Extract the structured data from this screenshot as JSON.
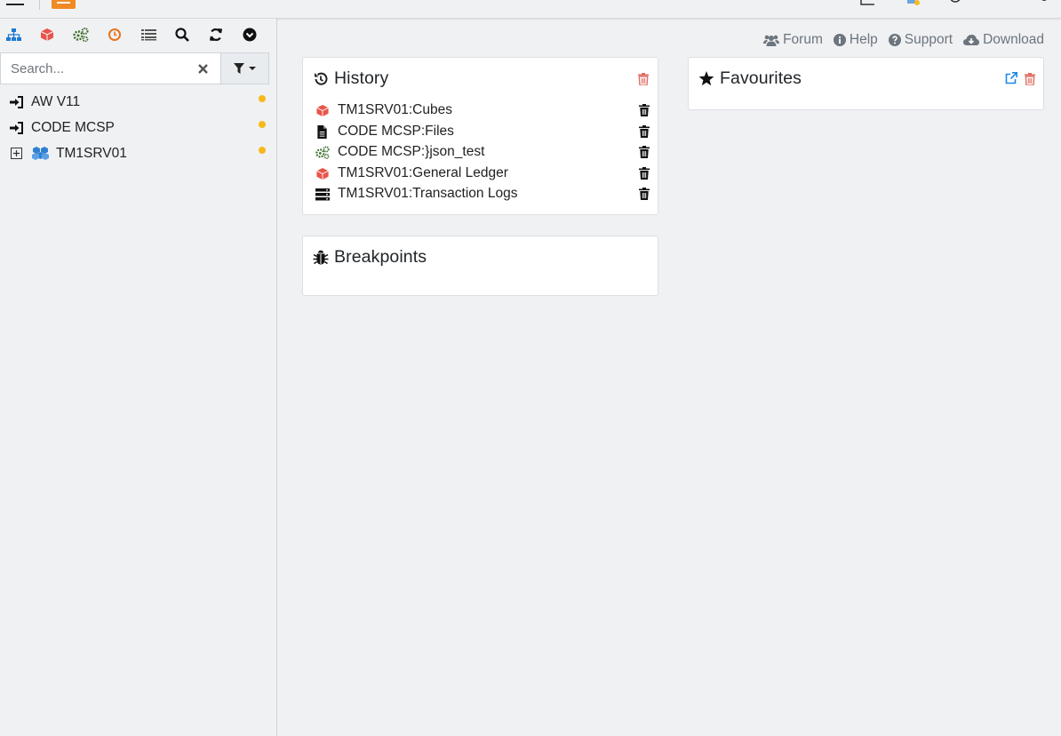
{
  "colors": {
    "accent_orange": "#f08a24",
    "trash_red": "#e06d62",
    "status_dot": "#f6b91a",
    "link_blue": "#1e88e5",
    "cube_red": "#e8554a",
    "process_green": "#3e6e2c"
  },
  "topbar": {
    "icons": [
      "menu-icon",
      "app-logo",
      "document-icon",
      "servers-icon",
      "circle-icon",
      "user-icon",
      "gear-icon"
    ]
  },
  "sidebar": {
    "toolbar": [
      "hierarchy-icon",
      "cube-icon",
      "processes-icon",
      "chores-icon",
      "list-icon",
      "search-icon",
      "refresh-icon",
      "chevron-circle-icon"
    ],
    "search": {
      "placeholder": "Search...",
      "value": ""
    },
    "tree": [
      {
        "label": "AW V11",
        "icon": "sign-in-icon"
      },
      {
        "label": "CODE MCSP",
        "icon": "sign-in-icon"
      },
      {
        "label": "TM1SRV01",
        "icon": "server-cubes-icon"
      }
    ]
  },
  "links": {
    "forum": "Forum",
    "help": "Help",
    "support": "Support",
    "download": "Download"
  },
  "history": {
    "title": "History",
    "items": [
      {
        "label": "TM1SRV01:Cubes",
        "icon": "cube-icon"
      },
      {
        "label": "CODE MCSP:Files",
        "icon": "file-icon"
      },
      {
        "label": "CODE MCSP:}json_test",
        "icon": "process-icon"
      },
      {
        "label": "TM1SRV01:General Ledger",
        "icon": "cube-icon"
      },
      {
        "label": "TM1SRV01:Transaction Logs",
        "icon": "logs-icon"
      }
    ]
  },
  "favourites": {
    "title": "Favourites"
  },
  "breakpoints": {
    "title": "Breakpoints"
  }
}
